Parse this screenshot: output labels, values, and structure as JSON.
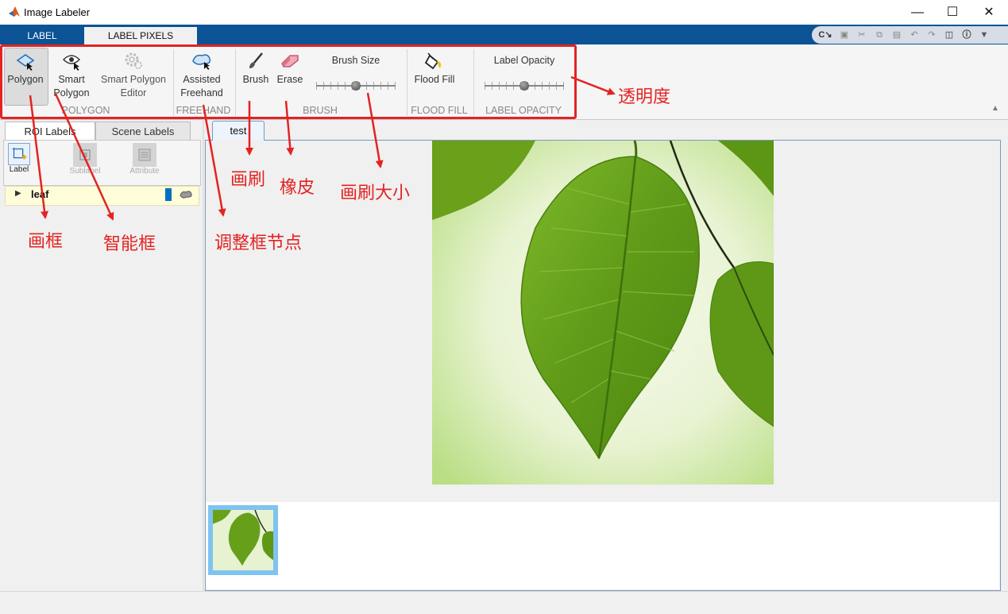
{
  "window": {
    "title": "Image Labeler"
  },
  "ribbon_tabs": [
    {
      "label": "LABEL"
    },
    {
      "label": "LABEL PIXELS"
    }
  ],
  "tools": {
    "polygon": {
      "label1": "Polygon"
    },
    "smart_polygon": {
      "label1": "Smart",
      "label2": "Polygon"
    },
    "smart_polygon_editor": {
      "label1": "Smart Polygon",
      "label2": "Editor"
    },
    "assisted_freehand": {
      "label1": "Assisted",
      "label2": "Freehand"
    },
    "brush": {
      "label1": "Brush"
    },
    "erase": {
      "label1": "Erase"
    },
    "brush_size": {
      "label": "Brush Size",
      "value": 0.5
    },
    "flood_fill": {
      "label1": "Flood Fill"
    },
    "label_opacity": {
      "label": "Label Opacity",
      "value": 0.5
    }
  },
  "groups": {
    "polygon": "POLYGON",
    "freehand": "FREEHAND",
    "brush": "BRUSH",
    "flood_fill": "FLOOD FILL",
    "label_opacity": "LABEL OPACITY"
  },
  "left_panel": {
    "tabs": [
      {
        "label": "ROI Labels"
      },
      {
        "label": "Scene Labels"
      }
    ],
    "buttons": {
      "label": "Label",
      "sublabel": "Sublabel",
      "attribute": "Attribute"
    },
    "labels": [
      {
        "name": "leaf",
        "color": "#0072bd"
      }
    ]
  },
  "document": {
    "tab": "test"
  },
  "annotations": {
    "opacity": "透明度",
    "brush": "画刷",
    "eraser": "橡皮",
    "brush_size": "画刷大小",
    "polygon": "画框",
    "smart_polygon": "智能框",
    "adjust_nodes": "调整框节点"
  },
  "colors": {
    "accent": "#0b5394",
    "annotation": "#e32322",
    "label_leaf": "#0072bd",
    "leaf": "#6aa01a"
  }
}
